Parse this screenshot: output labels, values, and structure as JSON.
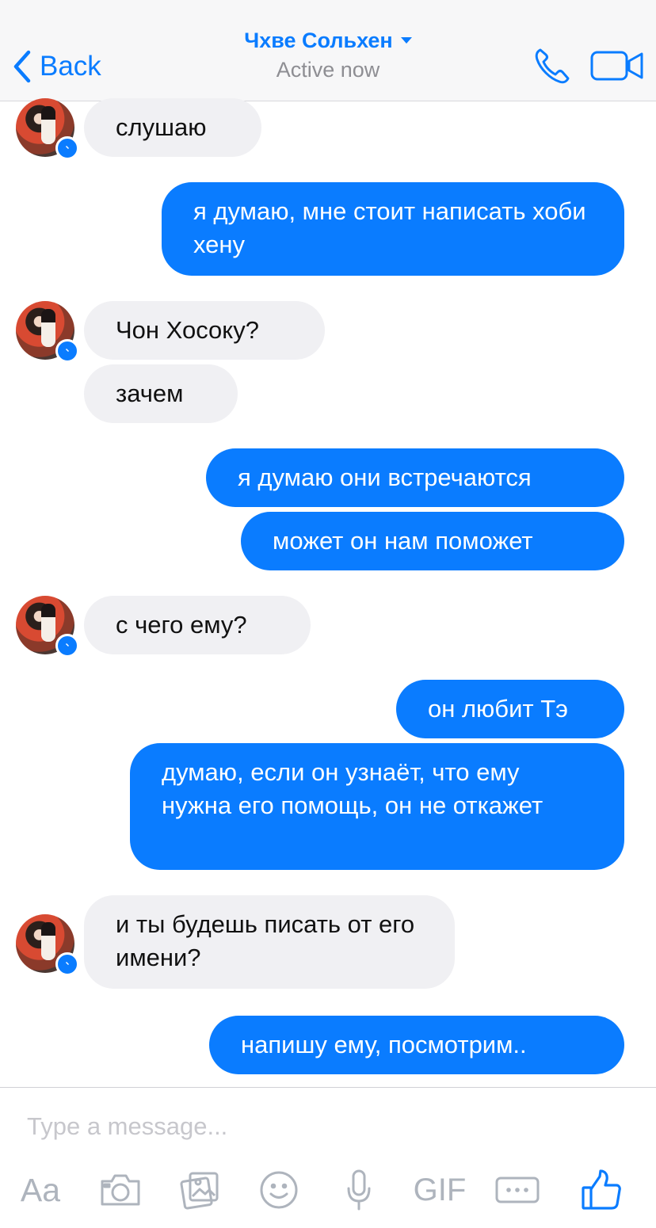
{
  "header": {
    "back_label": "Back",
    "title": "Чхве Сольхен",
    "status": "Active now"
  },
  "messages": [
    {
      "from": "contact",
      "text": "слушаю"
    },
    {
      "from": "me",
      "text": "я думаю, мне стоит написать хоби хену"
    },
    {
      "from": "contact",
      "text": "Чон Хосоку?"
    },
    {
      "from": "contact",
      "text": "зачем"
    },
    {
      "from": "me",
      "text": "я думаю они встречаются"
    },
    {
      "from": "me",
      "text": "может он нам поможет"
    },
    {
      "from": "contact",
      "text": "с чего ему?"
    },
    {
      "from": "me",
      "text": "он любит Тэ"
    },
    {
      "from": "me",
      "text": "думаю, если он узнаёт, что ему нужна его помощь, он не откажет"
    },
    {
      "from": "contact",
      "text": "и ты будешь писать от его имени?"
    },
    {
      "from": "me",
      "text": "напишу ему, посмотрим.."
    }
  ],
  "composer": {
    "placeholder": "Type a message...",
    "value": ""
  },
  "toolbar": {
    "text_format_label": "Aa",
    "gif_label": "GIF"
  },
  "icons": {
    "back": "chevron-left-icon",
    "call": "phone-icon",
    "video": "video-camera-icon",
    "avatar_badge": "messenger-icon",
    "camera": "camera-icon",
    "gallery": "image-gallery-icon",
    "emoji": "emoji-icon",
    "voice": "microphone-icon",
    "more": "more-icon",
    "like": "thumbs-up-icon"
  },
  "colors": {
    "accent": "#0a7cff",
    "incoming_bubble": "#f0f0f3",
    "header_background": "#f7f7f8",
    "toolbar_icon": "#aeb4bd"
  }
}
